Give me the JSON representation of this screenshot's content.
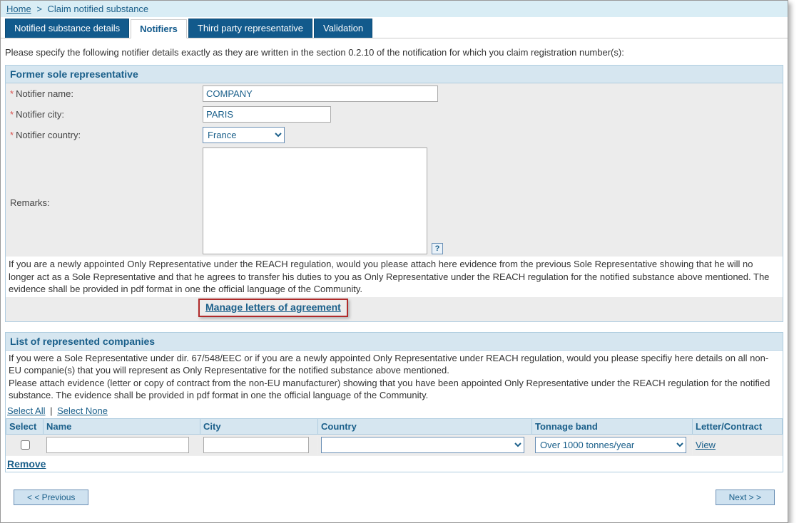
{
  "breadcrumb": {
    "home": "Home",
    "current": "Claim notified substance"
  },
  "tabs": [
    {
      "label": "Notified substance details"
    },
    {
      "label": "Notifiers"
    },
    {
      "label": "Third party representative"
    },
    {
      "label": "Validation"
    }
  ],
  "instructions": "Please specify the following notifier details exactly as they are written in the section 0.2.10 of the notification for which you claim registration number(s):",
  "section_former": {
    "title": "Former sole representative",
    "labels": {
      "name": "Notifier name:",
      "city": "Notifier city:",
      "country": "Notifier country:",
      "remarks": "Remarks:"
    },
    "values": {
      "name": "COMPANY",
      "city": "PARIS",
      "country": "France",
      "remarks": ""
    },
    "help": "?",
    "or_text": "If you are a newly appointed Only Representative under the REACH regulation, would you please attach here evidence from the previous Sole Representative showing that he will no longer act as a Sole Representative and that he agrees to transfer his duties to you as Only Representative under the REACH regulation for the notified substance above mentioned. The evidence shall be provided in pdf format in one the official language of the Community.",
    "manage_link": "Manage letters of agreement"
  },
  "section_list": {
    "title": "List of represented companies",
    "text": "If you were a Sole Representative under dir. 67/548/EEC or if you are a newly appointed Only Representative under REACH regulation, would you please specifiy here details on all non-EU companie(s) that you will represent as Only Representative for the notified substance above mentioned.\nPlease attach evidence (letter or copy of contract from the non-EU manufacturer) showing that you have been appointed Only Representative under the REACH regulation for the notified substance. The evidence shall be provided in pdf format in one the official language of the Community.",
    "select_all": "Select All",
    "select_none": "Select None",
    "columns": {
      "select": "Select",
      "name": "Name",
      "city": "City",
      "country": "Country",
      "tonnage": "Tonnage band",
      "letter": "Letter/Contract"
    },
    "row": {
      "name": "",
      "city": "",
      "country": "",
      "tonnage": "Over 1000 tonnes/year",
      "view": "View"
    },
    "remove": "Remove"
  },
  "nav": {
    "prev": "< < Previous",
    "next": "Next > >"
  }
}
